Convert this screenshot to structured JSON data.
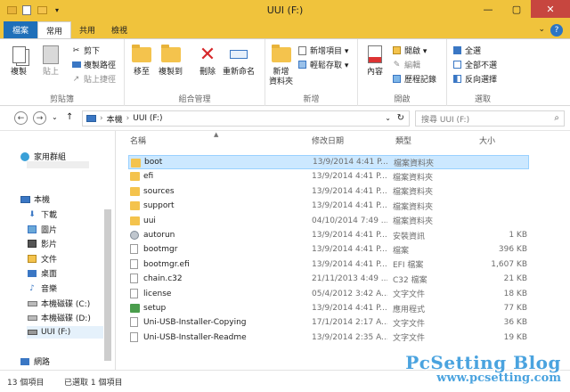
{
  "window": {
    "title": "UUI (F:)",
    "minimize": "—",
    "maximize": "▢",
    "close": "✕"
  },
  "tabs": {
    "file": "檔案",
    "home": "常用",
    "share": "共用",
    "view": "檢視",
    "help": "?",
    "chevron": "⌄"
  },
  "ribbon": {
    "clipboard": {
      "label": "剪貼簿",
      "copy": "複製",
      "paste": "貼上",
      "cut": "剪下",
      "copy_path": "複製路徑",
      "paste_shortcut": "貼上捷徑"
    },
    "organize": {
      "label": "組合管理",
      "move_to": "移至",
      "copy_to": "複製到",
      "delete": "刪除",
      "rename": "重新命名"
    },
    "new": {
      "label": "新增",
      "new_folder": "新增\n資料夾",
      "new_item": "新增項目 ▾",
      "easy_access": "輕鬆存取 ▾"
    },
    "open": {
      "label": "開啟",
      "properties": "內容",
      "open": "開啟 ▾",
      "edit": "編輯",
      "history": "歷程記錄"
    },
    "select": {
      "label": "選取",
      "select_all": "全選",
      "select_none": "全部不選",
      "invert": "反向選擇"
    }
  },
  "address": {
    "crumbs": [
      "本機",
      "UUI (F:)"
    ],
    "separator": "›",
    "search_placeholder": "搜尋 UUI (F:)"
  },
  "nav": {
    "homegroup": "家用群組",
    "this_pc": "本機",
    "items": [
      "下載",
      "圖片",
      "影片",
      "文件",
      "桌面",
      "音樂",
      "本機磁碟 (C:)",
      "本機磁碟 (D:)",
      "UUI (F:)"
    ],
    "network": "網路"
  },
  "columns": {
    "name": "名稱",
    "date": "修改日期",
    "type": "類型",
    "size": "大小"
  },
  "files": [
    {
      "name": "boot",
      "date": "13/9/2014 4:41 P...",
      "type": "檔案資料夾",
      "size": "",
      "icon": "folder"
    },
    {
      "name": "efi",
      "date": "13/9/2014 4:41 P...",
      "type": "檔案資料夾",
      "size": "",
      "icon": "folder"
    },
    {
      "name": "sources",
      "date": "13/9/2014 4:41 P...",
      "type": "檔案資料夾",
      "size": "",
      "icon": "folder"
    },
    {
      "name": "support",
      "date": "13/9/2014 4:41 P...",
      "type": "檔案資料夾",
      "size": "",
      "icon": "folder"
    },
    {
      "name": "uui",
      "date": "04/10/2014 7:49 ...",
      "type": "檔案資料夾",
      "size": "",
      "icon": "folder"
    },
    {
      "name": "autorun",
      "date": "13/9/2014 4:41 P...",
      "type": "安裝資訊",
      "size": "1 KB",
      "icon": "gear"
    },
    {
      "name": "bootmgr",
      "date": "13/9/2014 4:41 P...",
      "type": "檔案",
      "size": "396 KB",
      "icon": "doc"
    },
    {
      "name": "bootmgr.efi",
      "date": "13/9/2014 4:41 P...",
      "type": "EFI 檔案",
      "size": "1,607 KB",
      "icon": "doc"
    },
    {
      "name": "chain.c32",
      "date": "21/11/2013 4:49 ...",
      "type": "C32 檔案",
      "size": "21 KB",
      "icon": "doc"
    },
    {
      "name": "license",
      "date": "05/4/2012 3:42 A...",
      "type": "文字文件",
      "size": "18 KB",
      "icon": "doc"
    },
    {
      "name": "setup",
      "date": "13/9/2014 4:41 P...",
      "type": "應用程式",
      "size": "77 KB",
      "icon": "setup"
    },
    {
      "name": "Uni-USB-Installer-Copying",
      "date": "17/1/2014 2:17 A...",
      "type": "文字文件",
      "size": "36 KB",
      "icon": "doc"
    },
    {
      "name": "Uni-USB-Installer-Readme",
      "date": "13/9/2014 2:35 A...",
      "type": "文字文件",
      "size": "19 KB",
      "icon": "doc"
    }
  ],
  "status": {
    "count": "13 個項目",
    "selected": "已選取 1 個項目"
  },
  "watermark": {
    "line1": "PcSetting Blog",
    "line2": "www.pcsetting.com"
  },
  "colors": {
    "titlebar": "#f0c33c",
    "file_tab": "#1f6fb9",
    "folder": "#f4c34d",
    "selection": "#cce8ff"
  }
}
